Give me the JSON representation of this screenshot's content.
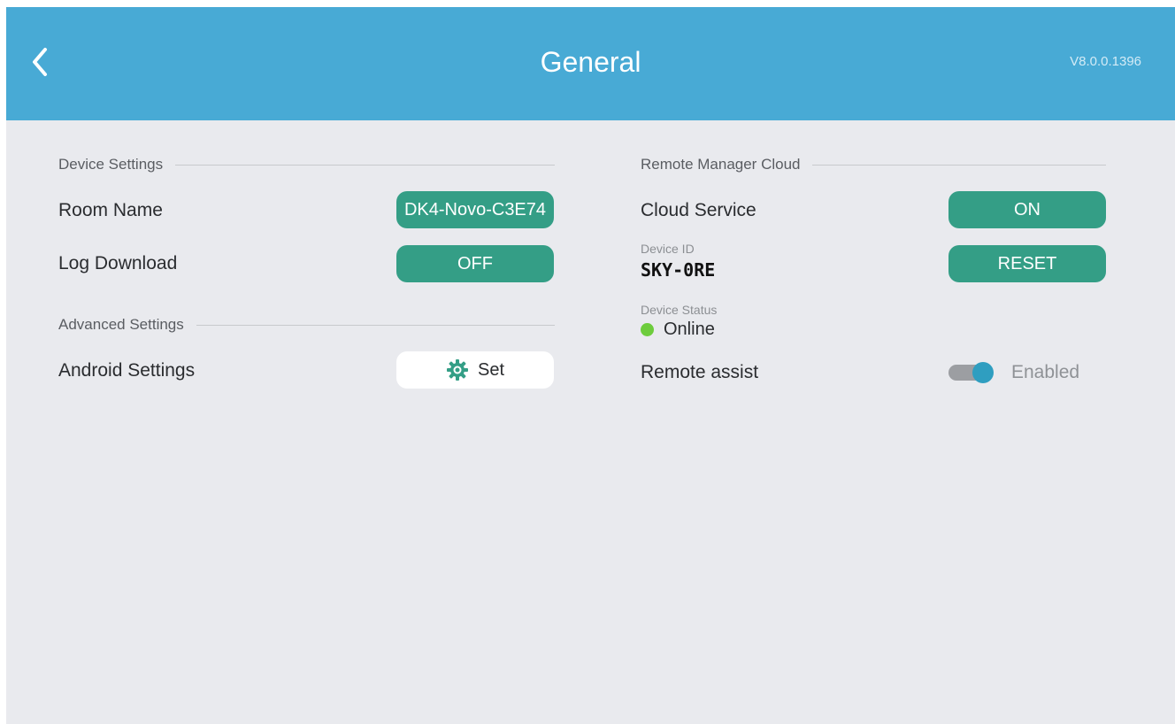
{
  "header": {
    "title": "General",
    "version": "V8.0.0.1396"
  },
  "colors": {
    "header_bg": "#48aad5",
    "button_green": "#349e86",
    "page_bg": "#e9eaee",
    "status_online": "#6dcc3c",
    "toggle_knob": "#2f9ec0"
  },
  "device_settings": {
    "section_title": "Device Settings",
    "room_name": {
      "label": "Room Name",
      "value": "DK4-Novo-C3E74"
    },
    "log_download": {
      "label": "Log Download",
      "value": "OFF"
    }
  },
  "advanced_settings": {
    "section_title": "Advanced Settings",
    "android_settings": {
      "label": "Android Settings",
      "button": "Set",
      "icon": "gear-icon"
    }
  },
  "remote_manager": {
    "section_title": "Remote Manager Cloud",
    "cloud_service": {
      "label": "Cloud Service",
      "value": "ON"
    },
    "device_id": {
      "label": "Device ID",
      "value": "SKY-0RE",
      "button": "RESET"
    },
    "device_status": {
      "label": "Device Status",
      "value": "Online"
    },
    "remote_assist": {
      "label": "Remote assist",
      "state": "Enabled",
      "on": true
    }
  }
}
